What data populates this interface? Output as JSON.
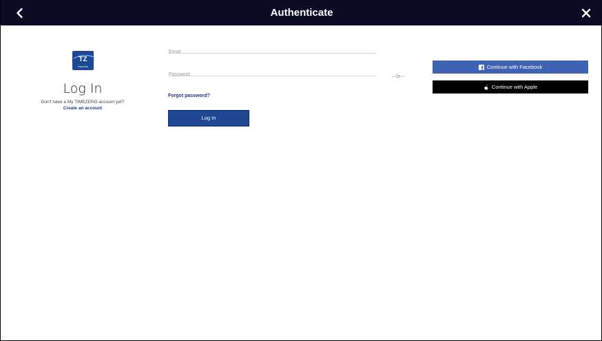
{
  "header": {
    "title": "Authenticate"
  },
  "brand": {
    "logo_text": "TZ",
    "logo_subtext": "TIMEZERO",
    "color": "#1e4794"
  },
  "left": {
    "heading": "Log In",
    "no_account_text": "Don't have a My TIMEZERO account yet?",
    "create_account_link": "Create an account"
  },
  "form": {
    "email_placeholder": "Email",
    "password_placeholder": "Password",
    "forgot_password_link": "Forgot password?",
    "login_button": "Log In"
  },
  "separator": "– Or –",
  "social": {
    "facebook_label": "Continue with Facebook",
    "apple_label": "Continue with Apple"
  },
  "colors": {
    "titlebar": "#0b0b24",
    "facebook": "#3e63b2",
    "apple": "#000000",
    "link": "#1a3a8a"
  },
  "icons": {
    "back": "chevron-left-icon",
    "close": "close-icon",
    "facebook": "facebook-icon",
    "apple": "apple-icon"
  }
}
